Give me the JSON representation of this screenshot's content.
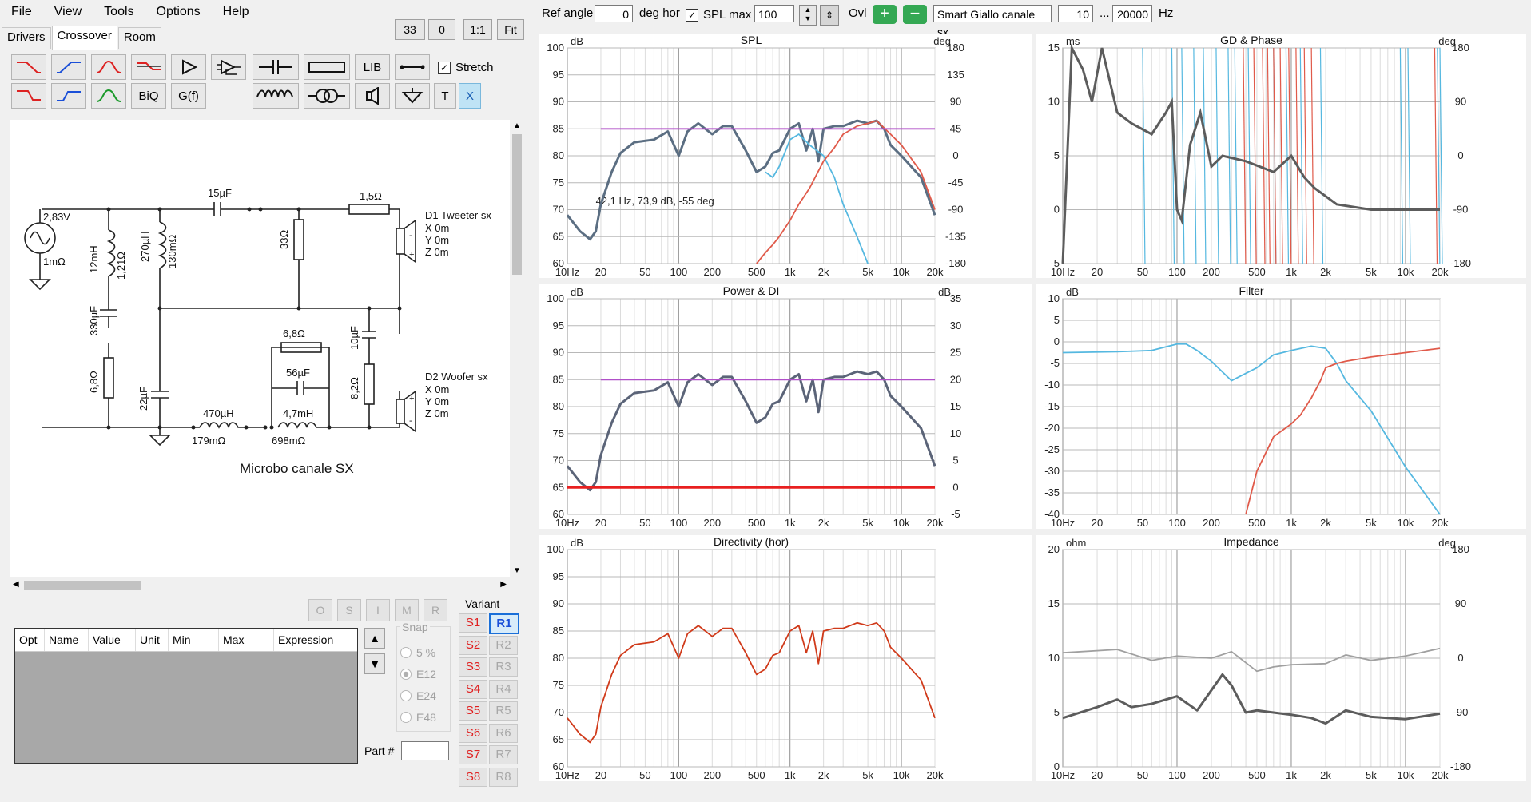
{
  "menu": {
    "file": "File",
    "view": "View",
    "tools": "Tools",
    "options": "Options",
    "help": "Help"
  },
  "topbuttons": {
    "b1": "33",
    "b2": "0",
    "b3": "1:1",
    "b4": "Fit"
  },
  "tabs": {
    "drivers": "Drivers",
    "crossover": "Crossover",
    "room": "Room"
  },
  "toolbox": {
    "lib": "LIB",
    "biq": "BiQ",
    "gf": "G(f)",
    "t": "T",
    "x": "X",
    "stretch": "Stretch"
  },
  "schematic": {
    "title": "Microbo canale SX",
    "source_voltage": "2,83V",
    "source_res": "1mΩ",
    "c1": "15µF",
    "r1": "1,5Ω",
    "r2": "33Ω",
    "l1": "12mH",
    "l1r": "1,21Ω",
    "l2": "270µH",
    "l2r": "130mΩ",
    "c2": "330µF",
    "r3": "6,8Ω",
    "c3": "22µF",
    "l3": "470µH",
    "l3r": "179mΩ",
    "l4": "4,7mH",
    "l4r": "698mΩ",
    "r4": "6,8Ω",
    "c4": "56µF",
    "c5": "10µF",
    "r5": "8,2Ω",
    "d1_name": "D1 Tweeter sx",
    "d1_x": "X 0m",
    "d1_y": "Y 0m",
    "d1_z": "Z 0m",
    "d2_name": "D2 Woofer sx",
    "d2_x": "X 0m",
    "d2_y": "Y 0m",
    "d2_z": "Z 0m"
  },
  "opt_buttons": {
    "o": "O",
    "s": "S",
    "i": "I",
    "m": "M",
    "r": "R"
  },
  "param_table": {
    "headers": [
      "Opt",
      "Name",
      "Value",
      "Unit",
      "Min",
      "Max",
      "Expression"
    ]
  },
  "snap": {
    "title": "Snap",
    "options": [
      "5 %",
      "E12",
      "E24",
      "E48"
    ]
  },
  "part_label": "Part #",
  "variant": {
    "title": "Variant",
    "s": [
      "S1",
      "S2",
      "S3",
      "S4",
      "S5",
      "S6",
      "S7",
      "S8"
    ],
    "r": [
      "R1",
      "R2",
      "R3",
      "R4",
      "R5",
      "R6",
      "R7",
      "R8"
    ]
  },
  "toolbar": {
    "ref_angle_label": "Ref angle",
    "ref_angle": "0",
    "deg_hor": "deg hor",
    "spl_max_label": "SPL max",
    "spl_max": "100",
    "ovl": "Ovl",
    "driver_name": "Smart Giallo canale sx",
    "f_min": "10",
    "dots": "...",
    "f_max": "20000",
    "hz": "Hz"
  },
  "freq_ticks": [
    "10Hz",
    "20",
    "50",
    "100",
    "200",
    "500",
    "1k",
    "2k",
    "5k",
    "10k",
    "20k"
  ],
  "chart_data": [
    {
      "type": "line",
      "title": "SPL",
      "ylabel": "dB",
      "y2label": "deg",
      "ylim": [
        60,
        100
      ],
      "y2lim": [
        -180,
        180
      ],
      "yticks": [
        "100",
        "95",
        "90",
        "85",
        "80",
        "75",
        "70",
        "65",
        "60"
      ],
      "y2ticks": [
        "180",
        "135",
        "90",
        "45",
        "0",
        "-45",
        "-90",
        "-135",
        "-180"
      ],
      "annotation": "42,1 Hz, 73,9 dB, -55 deg",
      "series": [
        {
          "color": "#5b6e82",
          "x": [
            10,
            13,
            16,
            18,
            20,
            25,
            30,
            40,
            60,
            80,
            100,
            120,
            150,
            200,
            250,
            300,
            400,
            500,
            600,
            700,
            800,
            1000,
            1200,
            1400,
            1600,
            1800,
            2000,
            2500,
            3000,
            4000,
            5000,
            6000,
            7000,
            8000,
            10000,
            15000,
            20000
          ],
          "y": [
            69,
            66,
            64.5,
            66,
            71,
            77,
            80.5,
            82.5,
            83,
            84.5,
            80,
            84.5,
            86,
            84,
            85.5,
            85.5,
            81,
            77,
            78,
            80.5,
            81,
            85,
            86,
            81,
            85,
            79,
            85,
            85.5,
            85.5,
            86.5,
            86,
            86.5,
            85,
            82,
            80,
            76,
            69
          ]
        },
        {
          "color": "#55b8e0",
          "x": [
            600,
            700,
            800,
            1000,
            1200,
            1500,
            2000,
            2500,
            3000,
            4000,
            5000
          ],
          "y": [
            77,
            76,
            78,
            83,
            84,
            82,
            80,
            76,
            71,
            65,
            60
          ]
        },
        {
          "color": "#e05a4a",
          "x": [
            500,
            600,
            700,
            800,
            1000,
            1200,
            1500,
            2000,
            2500,
            3000,
            4000,
            5000,
            6000,
            8000,
            10000,
            15000,
            20000
          ],
          "y": [
            60,
            62,
            63.5,
            65,
            68,
            71,
            74,
            79,
            81.5,
            84,
            85.5,
            86,
            86.5,
            84,
            82,
            77,
            70
          ]
        },
        {
          "color": "#b050c8",
          "x": [
            20,
            20000
          ],
          "y": [
            85,
            85
          ]
        }
      ]
    },
    {
      "type": "line",
      "title": "GD & Phase",
      "ylabel": "ms",
      "y2label": "deg",
      "ylim": [
        -5,
        15
      ],
      "y2lim": [
        -180,
        180
      ],
      "yticks": [
        "15",
        "10",
        "5",
        "0",
        "-5"
      ],
      "y2ticks": [
        "180",
        "90",
        "0",
        "-90",
        "-180"
      ]
    },
    {
      "type": "line",
      "title": "Power & DI",
      "ylabel": "dB",
      "y2label": "dB",
      "ylim": [
        60,
        100
      ],
      "y2lim": [
        -5,
        35
      ],
      "yticks": [
        "100",
        "95",
        "90",
        "85",
        "80",
        "75",
        "70",
        "65",
        "60"
      ],
      "y2ticks": [
        "35",
        "30",
        "25",
        "20",
        "15",
        "10",
        "5",
        "0",
        "-5"
      ],
      "series": [
        {
          "color": "#5b6478",
          "x": [
            10,
            13,
            16,
            18,
            20,
            25,
            30,
            40,
            60,
            80,
            100,
            120,
            150,
            200,
            250,
            300,
            400,
            500,
            600,
            700,
            800,
            1000,
            1200,
            1400,
            1600,
            1800,
            2000,
            2500,
            3000,
            4000,
            5000,
            6000,
            7000,
            8000,
            10000,
            15000,
            20000
          ],
          "y": [
            69,
            66,
            64.5,
            66,
            71,
            77,
            80.5,
            82.5,
            83,
            84.5,
            80,
            84.5,
            86,
            84,
            85.5,
            85.5,
            81,
            77,
            78,
            80.5,
            81,
            85,
            86,
            81,
            85,
            79,
            85,
            85.5,
            85.5,
            86.5,
            86,
            86.5,
            85,
            82,
            80,
            76,
            69
          ]
        },
        {
          "color": "#b050c8",
          "x": [
            20,
            20000
          ],
          "y": [
            85,
            85
          ]
        },
        {
          "color": "#e82020",
          "x": [
            10,
            20000
          ],
          "y": [
            65,
            65
          ]
        }
      ]
    },
    {
      "type": "line",
      "title": "Filter",
      "ylabel": "dB",
      "ylim": [
        -40,
        10
      ],
      "yticks": [
        "10",
        "5",
        "0",
        "-5",
        "-10",
        "-15",
        "-20",
        "-25",
        "-30",
        "-35",
        "-40"
      ],
      "series": [
        {
          "color": "#55b8e0",
          "x": [
            10,
            30,
            60,
            100,
            120,
            150,
            200,
            300,
            500,
            700,
            1000,
            1500,
            2000,
            2500,
            3000,
            5000,
            10000,
            20000
          ],
          "y": [
            -2.5,
            -2.3,
            -2,
            -0.5,
            -0.5,
            -2,
            -4.5,
            -9,
            -6,
            -3,
            -2,
            -1,
            -1.5,
            -5,
            -9,
            -16,
            -29,
            -40
          ]
        },
        {
          "color": "#e05a4a",
          "x": [
            400,
            500,
            700,
            1000,
            1200,
            1500,
            1800,
            2000,
            2500,
            3000,
            5000,
            10000,
            20000
          ],
          "y": [
            -40,
            -30,
            -22,
            -19,
            -17,
            -13,
            -9,
            -6,
            -5,
            -4.5,
            -3.5,
            -2.5,
            -1.5
          ]
        }
      ]
    },
    {
      "type": "line",
      "title": "Directivity (hor)",
      "ylabel": "dB",
      "ylim": [
        60,
        100
      ],
      "yticks": [
        "100",
        "95",
        "90",
        "85",
        "80",
        "75",
        "70",
        "65",
        "60"
      ],
      "series": [
        {
          "color": "#d03a1a",
          "x": [
            10,
            13,
            16,
            18,
            20,
            25,
            30,
            40,
            60,
            80,
            100,
            120,
            150,
            200,
            250,
            300,
            400,
            500,
            600,
            700,
            800,
            1000,
            1200,
            1400,
            1600,
            1800,
            2000,
            2500,
            3000,
            4000,
            5000,
            6000,
            7000,
            8000,
            10000,
            15000,
            20000
          ],
          "y": [
            69,
            66,
            64.5,
            66,
            71,
            77,
            80.5,
            82.5,
            83,
            84.5,
            80,
            84.5,
            86,
            84,
            85.5,
            85.5,
            81,
            77,
            78,
            80.5,
            81,
            85,
            86,
            81,
            85,
            79,
            85,
            85.5,
            85.5,
            86.5,
            86,
            86.5,
            85,
            82,
            80,
            76,
            69
          ]
        }
      ]
    },
    {
      "type": "line",
      "title": "Impedance",
      "ylabel": "ohm",
      "y2label": "deg",
      "ylim": [
        0,
        20
      ],
      "y2lim": [
        -180,
        180
      ],
      "yticks": [
        "20",
        "15",
        "10",
        "5",
        "0"
      ],
      "y2ticks": [
        "180",
        "90",
        "0",
        "-90",
        "-180"
      ],
      "series": [
        {
          "color": "#5c5c5c",
          "x": [
            10,
            20,
            30,
            40,
            60,
            100,
            150,
            250,
            300,
            400,
            500,
            700,
            1000,
            1500,
            2000,
            3000,
            5000,
            10000,
            20000
          ],
          "y": [
            4.5,
            5.5,
            6.2,
            5.5,
            5.8,
            6.5,
            5.2,
            8.5,
            7.5,
            5,
            5.2,
            5,
            4.8,
            4.5,
            4,
            5.2,
            4.6,
            4.4,
            4.9
          ]
        },
        {
          "color": "#a0a0a0",
          "x": [
            10,
            30,
            60,
            100,
            200,
            300,
            500,
            700,
            1000,
            2000,
            3000,
            5000,
            10000,
            20000
          ],
          "y": [
            10.5,
            10.8,
            9.8,
            10.2,
            10,
            10.6,
            8.8,
            9.2,
            9.4,
            9.5,
            10.3,
            9.8,
            10.2,
            10.9
          ]
        }
      ]
    }
  ]
}
